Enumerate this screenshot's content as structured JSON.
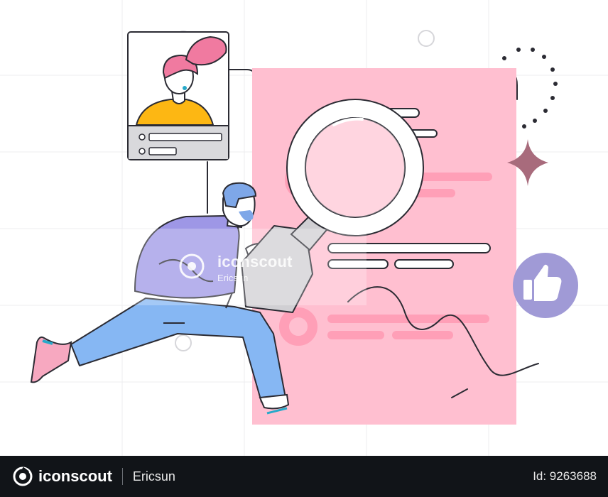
{
  "watermark": {
    "brand": "iconscout",
    "author": "Ericsun"
  },
  "footer": {
    "brand": "iconscout",
    "author": "Ericsun",
    "asset_id": "Id: 9263688"
  },
  "colors": {
    "document": "#ffbfd0",
    "profile_hair": "#f07aa0",
    "profile_shirt": "#fdb713",
    "man_shirt": "#9e97e6",
    "man_pants": "#86b7f3",
    "man_hair": "#7ea7e8",
    "shoe": "#f7a8c0",
    "like_badge": "#a09ad6",
    "sparkle": "#a86b7c",
    "footer_bg": "#111418"
  },
  "icons": [
    "magnifier-icon",
    "thumbs-up-icon",
    "sparkle-icon",
    "search-watermark-icon"
  ]
}
